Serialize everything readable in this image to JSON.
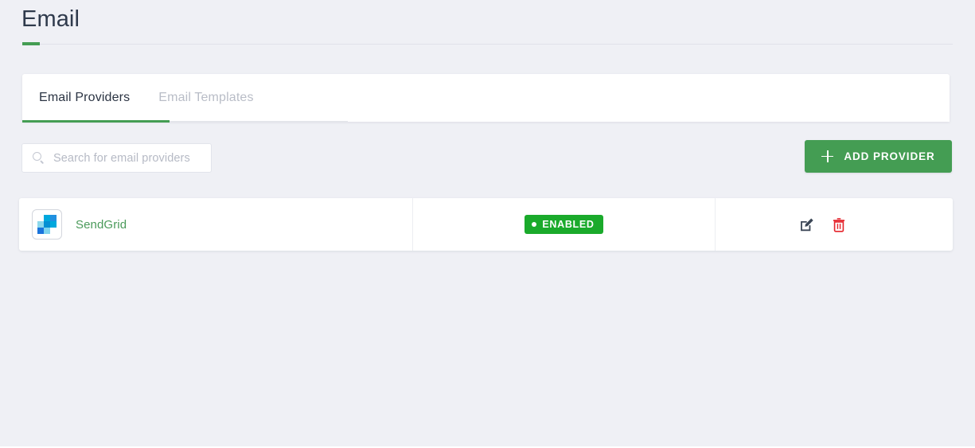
{
  "header": {
    "title": "Email"
  },
  "tabs": [
    {
      "label": "Email Providers",
      "active": true
    },
    {
      "label": "Email Templates",
      "active": false
    }
  ],
  "toolbar": {
    "search_placeholder": "Search for email providers",
    "search_value": "",
    "search_icon": "search-icon",
    "add_provider_label": "ADD PROVIDER",
    "add_provider_icon": "plus-icon"
  },
  "table": {
    "rows": [
      {
        "name": "SendGrid",
        "logo_icon": "sendgrid-logo",
        "status": "ENABLED",
        "status_color": "#1aaa2b",
        "actions": [
          {
            "name": "edit-icon",
            "label": "Edit"
          },
          {
            "name": "delete-icon",
            "label": "Delete"
          }
        ]
      }
    ]
  },
  "colors": {
    "accent_green": "#449d53",
    "status_green": "#1aaa2b",
    "link_green": "#4a9a5a",
    "page_background": "#eff0f5",
    "card_background": "#ffffff",
    "title_text": "#2f3a4c",
    "inactive_tab": "#b9bdc7",
    "delete_red": "#e5232b",
    "edit_dark": "#3b4656"
  },
  "logo_palette": {
    "cyan": "#00a8dd",
    "blue": "#2090e0",
    "light_blue": "#8cd8ec",
    "mid_blue": "#0490d4",
    "deep_blue": "#1a74dc",
    "pale_blue": "#7fd4ee"
  }
}
